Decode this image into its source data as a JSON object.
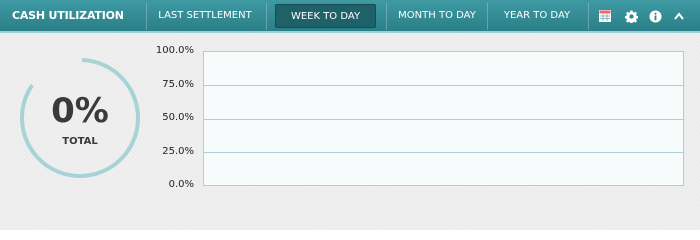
{
  "widget": {
    "title": "CASH UTILIZATION",
    "tabs": [
      {
        "label": "LAST SETTLEMENT",
        "active": false
      },
      {
        "label": "WEEK TO DAY",
        "active": true
      },
      {
        "label": "MONTH TO DAY",
        "active": false
      },
      {
        "label": "YEAR TO DAY",
        "active": false
      }
    ],
    "icons": [
      "calendar-icon",
      "gear-icon",
      "info-icon",
      "chevron-up-icon"
    ]
  },
  "gauge": {
    "value_text": "0%",
    "label": "TOTAL",
    "fraction": 0
  },
  "colors": {
    "header": "#2e858e",
    "accent": "#a8d3d6",
    "text": "#3a3a3a"
  },
  "chart_data": {
    "type": "bar",
    "title": "",
    "xlabel": "",
    "ylabel": "",
    "ylim": [
      0,
      100
    ],
    "yticks": [
      "100.0%",
      "75.0%",
      "50.0%",
      "25.0%",
      "0.0%"
    ],
    "categories": [],
    "values": [],
    "grid": true
  }
}
